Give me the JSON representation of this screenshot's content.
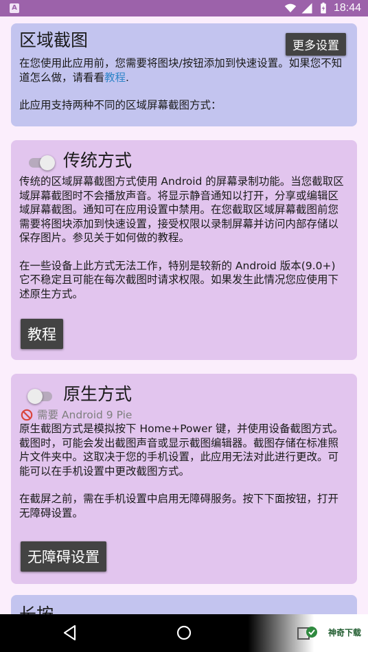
{
  "status_bar": {
    "time": "18:44",
    "app_icon_letter": "A",
    "icons": [
      "wifi-icon",
      "signal-icon",
      "battery-charging-icon"
    ]
  },
  "card_region": {
    "title": "区域截图",
    "more_settings_button": "更多设置",
    "intro_before_link": "在您使用此应用前，您需要将图块/按钮添加到快速设置。如果您不知道怎么做，请看看",
    "intro_link": "教程",
    "intro_after_link": ".",
    "methods_text": "此应用支持两种不同的区域屏幕截图方式："
  },
  "card_legacy": {
    "title": "传统方式",
    "toggle_on": false,
    "paragraph1": "传统的区域屏幕截图方式使用 Android 的屏幕录制功能。当您截取区域屏幕截图时不会播放声音。将显示静音通知以打开，分享或编辑区域屏幕截图。通知可在应用设置中禁用。在您截取区域屏幕截图前您需要将图块添加到快速设置，接受权限以录制屏幕并访问内部存储以保存图片。参见关于如何做的教程。",
    "paragraph2": "在一些设备上此方式无法工作，特别是较新的 Android 版本(9.0+) 它不稳定且可能在每次截图时请求权限。如果发生此情况您应使用下述原生方式。",
    "tutorial_button": "教程"
  },
  "card_native": {
    "title": "原生方式",
    "toggle_on": false,
    "requirement": "需要 Android 9 Pie",
    "paragraph1": "原生截图方式是模拟按下 Home+Power 键，并使用设备截图方式。截图时，可能会发出截图声音或显示截图编辑器。截图存储在标准照片文件夹中。这取决于您的手机设置，此应用无法对此进行更改。可能可以在手机设置中更改截图方式。",
    "paragraph2": "在截屏之前，需在手机设置中启用无障碍服务。按下下面按钮，打开无障碍设置。",
    "accessibility_button": "无障碍设置"
  },
  "card_longpress": {
    "title_partial": "长按"
  },
  "nav_bar": {
    "icons": [
      "back-icon",
      "home-icon",
      "recents-icon"
    ],
    "watermark_text": "神奇下载"
  },
  "colors": {
    "status_bar": "#9c62aa",
    "background": "#fbeefc",
    "card_blue": "#c3c4ef",
    "card_purple": "#e2c5ee",
    "button": "#434343",
    "link": "#2e84c8"
  }
}
